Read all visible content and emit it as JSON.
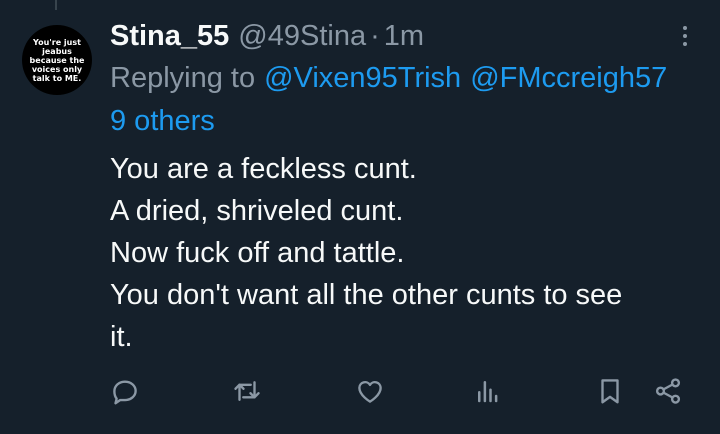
{
  "tweet": {
    "avatar_text": "You're just\njeabus\nbecause the\nvoices only\ntalk to ME.",
    "display_name": "Stina_55",
    "handle": "@49Stina",
    "separator": "·",
    "time": "1m",
    "reply_prefix": "Replying to",
    "mentions": [
      "@Vixen95Trish",
      "@FMccreigh57"
    ],
    "others": "9 others",
    "body_lines": [
      "You are a feckless cunt.",
      "A dried, shriveled cunt.",
      "Now fuck off and tattle.",
      "You don't want all the other cunts to see",
      "it."
    ]
  },
  "actions": [
    {
      "icon": "reply-icon"
    },
    {
      "icon": "retweet-icon"
    },
    {
      "icon": "like-icon"
    },
    {
      "icon": "views-icon"
    },
    {
      "icon": "bookmark-icon"
    },
    {
      "icon": "share-icon"
    }
  ],
  "colors": {
    "background": "#15202b",
    "text": "#f7f9f9",
    "secondary": "#8b98a5",
    "link": "#1d9bf0"
  }
}
